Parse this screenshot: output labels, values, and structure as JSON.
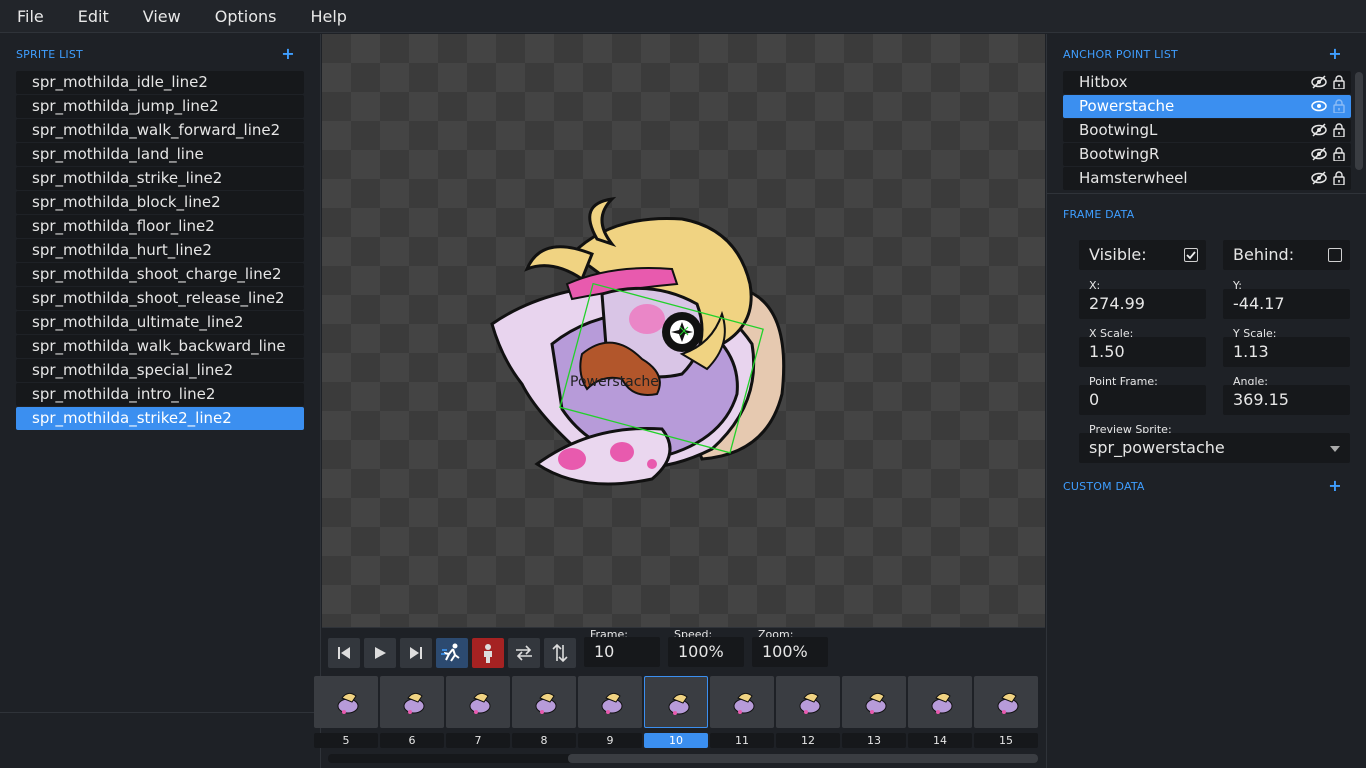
{
  "menu": [
    "File",
    "Edit",
    "View",
    "Options",
    "Help"
  ],
  "sprite_list": {
    "title": "SPRITE LIST",
    "items": [
      "spr_mothilda_idle_line2",
      "spr_mothilda_jump_line2",
      "spr_mothilda_walk_forward_line2",
      "spr_mothilda_land_line",
      "spr_mothilda_strike_line2",
      "spr_mothilda_block_line2",
      "spr_mothilda_floor_line2",
      "spr_mothilda_hurt_line2",
      "spr_mothilda_shoot_charge_line2",
      "spr_mothilda_shoot_release_line2",
      "spr_mothilda_ultimate_line2",
      "spr_mothilda_walk_backward_line",
      "spr_mothilda_special_line2",
      "spr_mothilda_intro_line2",
      "spr_mothilda_strike2_line2"
    ],
    "selected_index": 14
  },
  "canvas": {
    "anchor_label": "Powerstache"
  },
  "playback": {
    "frame_label": "Frame:",
    "frame_value": "10",
    "speed_label": "Speed:",
    "speed_value": "100%",
    "zoom_label": "Zoom:",
    "zoom_value": "100%"
  },
  "timeline": {
    "frames": [
      "5",
      "6",
      "7",
      "8",
      "9",
      "10",
      "11",
      "12",
      "13",
      "14",
      "15"
    ],
    "selected_frame": "10"
  },
  "anchor_points": {
    "title": "ANCHOR POINT LIST",
    "items": [
      "Hitbox",
      "Powerstache",
      "BootwingL",
      "BootwingR",
      "Hamsterwheel"
    ],
    "selected_index": 1
  },
  "frame_data": {
    "title": "FRAME DATA",
    "visible_label": "Visible:",
    "visible_checked": true,
    "behind_label": "Behind:",
    "behind_checked": false,
    "x_label": "X:",
    "x_value": "274.99",
    "y_label": "Y:",
    "y_value": "-44.17",
    "xscale_label": "X Scale:",
    "xscale_value": "1.50",
    "yscale_label": "Y Scale:",
    "yscale_value": "1.13",
    "pointframe_label": "Point Frame:",
    "pointframe_value": "0",
    "angle_label": "Angle:",
    "angle_value": "369.15",
    "preview_label": "Preview Sprite:",
    "preview_value": "spr_powerstache"
  },
  "custom_data": {
    "title": "CUSTOM DATA"
  },
  "colors": {
    "accent": "#3b8ff0",
    "section_title": "#3f9eff"
  }
}
